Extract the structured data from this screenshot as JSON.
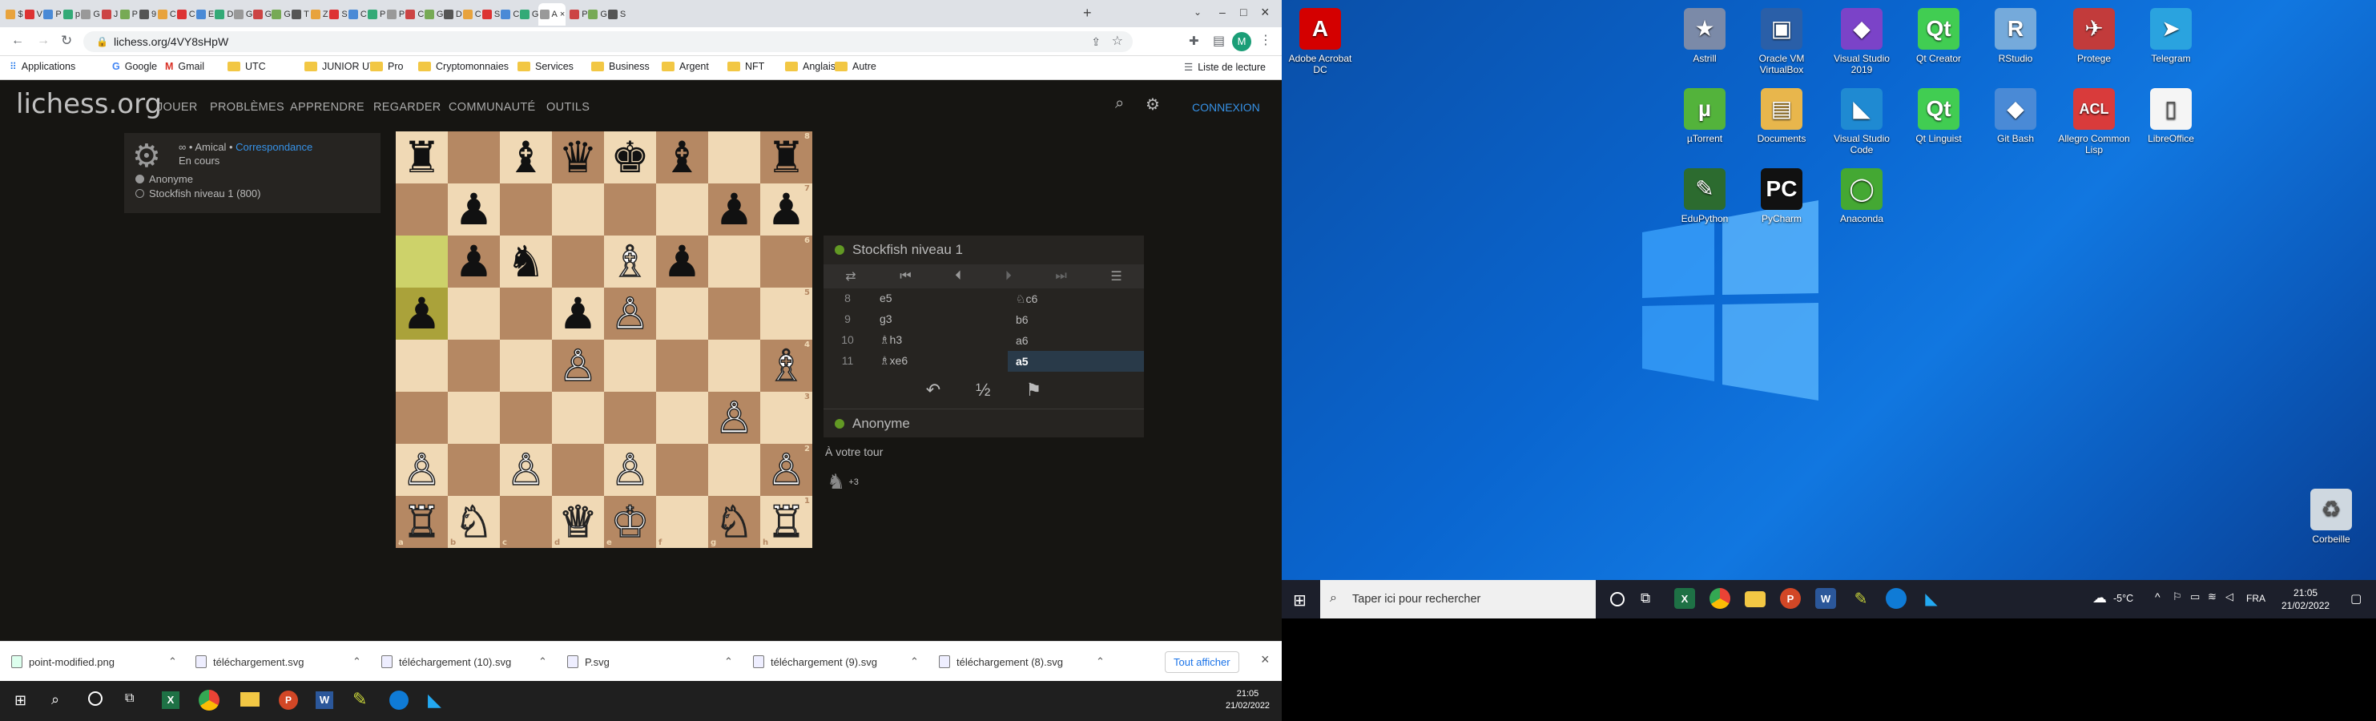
{
  "browser": {
    "tabs": [
      "$",
      "V",
      "P",
      "p",
      "G",
      "J",
      "P",
      "9",
      "C",
      "C",
      "E",
      "D",
      "G",
      "G",
      "G",
      "T",
      "Z",
      "S",
      "C",
      "P",
      "P",
      "C",
      "G",
      "D",
      "C",
      "S",
      "C",
      "G",
      "A",
      "P",
      "G",
      "S"
    ],
    "active_tab_close": "×",
    "new_tab": "+",
    "window_controls": {
      "minimize": "–",
      "maximize": "□",
      "close": "×"
    },
    "url": "lichess.org/4VY8sHpW",
    "avatar_letter": "M",
    "bookmarks": [
      "Applications",
      "Google",
      "Gmail",
      "UTC",
      "JUNIOR UTC",
      "Pro",
      "Cryptomonnaies",
      "Services",
      "Business",
      "Argent",
      "NFT",
      "Anglais",
      "Autre"
    ],
    "reading_list": "Liste de lecture"
  },
  "lichess": {
    "logo": "lichess.org",
    "nav": [
      "JOUER",
      "PROBLÈMES",
      "APPRENDRE",
      "REGARDER",
      "COMMUNAUTÉ",
      "OUTILS"
    ],
    "connexion": "CONNEXION",
    "game": {
      "type_prefix": "∞ • Amical •",
      "type_link": "Correspondance",
      "status": "En cours",
      "players": [
        "Anonyme",
        "Stockfish niveau 1 (800)"
      ]
    },
    "board": {
      "ranks": [
        "8",
        "7",
        "6",
        "5",
        "4",
        "3",
        "2",
        "1"
      ],
      "files": [
        "a",
        "b",
        "c",
        "d",
        "e",
        "f",
        "g",
        "h"
      ],
      "position": [
        [
          "r",
          "",
          "b",
          "q",
          "k",
          "b",
          "",
          "r"
        ],
        [
          "",
          "p",
          "",
          "",
          "",
          "",
          "p",
          "p"
        ],
        [
          "",
          "p",
          "n",
          "",
          "B",
          "p",
          "",
          ""
        ],
        [
          "p",
          "",
          "",
          "p",
          "P",
          "",
          "",
          ""
        ],
        [
          "",
          "",
          "",
          "P",
          "",
          "",
          "",
          "B"
        ],
        [
          "",
          "",
          "",
          "",
          "",
          "",
          "P",
          ""
        ],
        [
          "P",
          "",
          "P",
          "",
          "P",
          "",
          "",
          "P"
        ],
        [
          "R",
          "N",
          "",
          "Q",
          "K",
          "",
          "N",
          "R"
        ]
      ],
      "highlight": [
        "a6",
        "a5"
      ],
      "colors": {
        "light": "#f0d9b5",
        "dark": "#b58863",
        "hl_light": "#cdd26a",
        "hl_dark": "#aaa23a"
      }
    },
    "opponent": {
      "name": "Stockfish niveau 1",
      "online_color": "#629924"
    },
    "moves": [
      {
        "n": "8",
        "w": "e5",
        "b": "♘c6"
      },
      {
        "n": "9",
        "w": "g3",
        "b": "b6"
      },
      {
        "n": "10",
        "w": "♗h3",
        "b": "a6"
      },
      {
        "n": "11",
        "w": "♗xe6",
        "b": "a5"
      }
    ],
    "actions": {
      "takeback": "↶",
      "draw": "½",
      "resign": "⚑"
    },
    "player": {
      "name": "Anonyme"
    },
    "turn_text": "À votre tour",
    "material": "+3"
  },
  "downloads": {
    "items": [
      "point-modified.png",
      "téléchargement.svg",
      "téléchargement (10).svg",
      "P.svg",
      "téléchargement (9).svg",
      "téléchargement (8).svg"
    ],
    "show_all": "Tout afficher",
    "close": "×"
  },
  "left_taskbar": {
    "time": "21:05",
    "date": "21/02/2022"
  },
  "desktop": {
    "icons": [
      {
        "label": "Adobe Acrobat DC",
        "glyph": "A",
        "color": "#d40000"
      },
      {
        "label": "Astrill",
        "glyph": "★",
        "color": "#7b8aa8"
      },
      {
        "label": "Oracle VM VirtualBox",
        "glyph": "▣",
        "color": "#2a5fa8"
      },
      {
        "label": "Visual Studio 2019",
        "glyph": "◆",
        "color": "#7b43c8"
      },
      {
        "label": "Qt Creator",
        "glyph": "Qt",
        "color": "#41cd52"
      },
      {
        "label": "RStudio",
        "glyph": "R",
        "color": "#75aadb"
      },
      {
        "label": "Protege",
        "glyph": "✈",
        "color": "#c23b3b"
      },
      {
        "label": "Telegram",
        "glyph": "➤",
        "color": "#2aa3df"
      },
      {
        "label": "µTorrent",
        "glyph": "µ",
        "color": "#53b33b"
      },
      {
        "label": "Documents",
        "glyph": "▤",
        "color": "#e8b64c"
      },
      {
        "label": "Visual Studio Code",
        "glyph": "◣",
        "color": "#1f8ad2"
      },
      {
        "label": "Qt Linguist",
        "glyph": "Qt",
        "color": "#41cd52"
      },
      {
        "label": "Git Bash",
        "glyph": "◆",
        "color": "#4a8ad6"
      },
      {
        "label": "Allegro Common Lisp",
        "glyph": "ACL",
        "color": "#d93b3b"
      },
      {
        "label": "LibreOffice",
        "glyph": "▯",
        "color": "#f5f5f5"
      },
      {
        "label": "EduPython",
        "glyph": "✎",
        "color": "#2c6b2f"
      },
      {
        "label": "PyCharm",
        "glyph": "PC",
        "color": "#111111"
      },
      {
        "label": "Anaconda",
        "glyph": "◯",
        "color": "#44a833"
      },
      {
        "label": "Corbeille",
        "glyph": "♻",
        "color": "#cfd8e0"
      }
    ],
    "taskbar": {
      "search_placeholder": "Taper ici pour rechercher",
      "weather": "-5°C",
      "lang": "FRA",
      "time": "21:05",
      "date": "21/02/2022"
    }
  }
}
